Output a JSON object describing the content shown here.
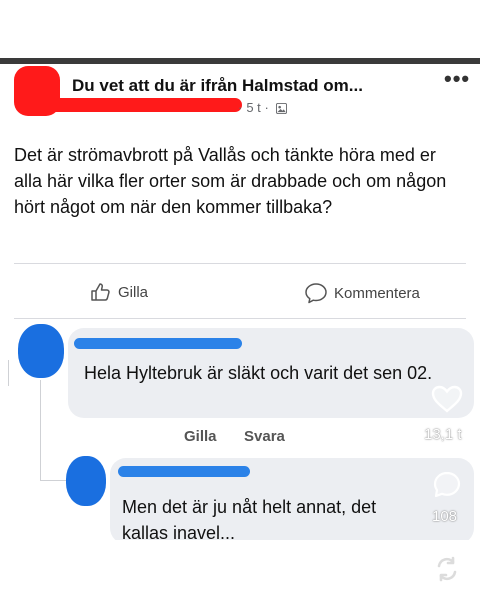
{
  "post": {
    "group_title": "Du vet att du är ifrån Halmstad om...",
    "time": "5 t",
    "dot": "·",
    "more_label": "•••",
    "body": "Det är strömavbrott på Vallås och tänkte höra med er alla här vilka fler orter som är drabbade och om någon hört något om när den kommer tillbaka?"
  },
  "actions": {
    "like_label": "Gilla",
    "comment_label": "Kommentera"
  },
  "comments": [
    {
      "text": "Hela Hyltebruk är släkt och varit det sen 02.",
      "like_label": "Gilla",
      "reply_label": "Svara"
    },
    {
      "text": "Men det är ju nåt helt annat, det kallas inavel..."
    }
  ],
  "overlay": {
    "likes_count": "13,1 t",
    "comments_count": "108"
  },
  "colors": {
    "redaction_red": "#ff1a1a",
    "redaction_blue": "#1a6fe0",
    "bubble": "#eceef2"
  }
}
